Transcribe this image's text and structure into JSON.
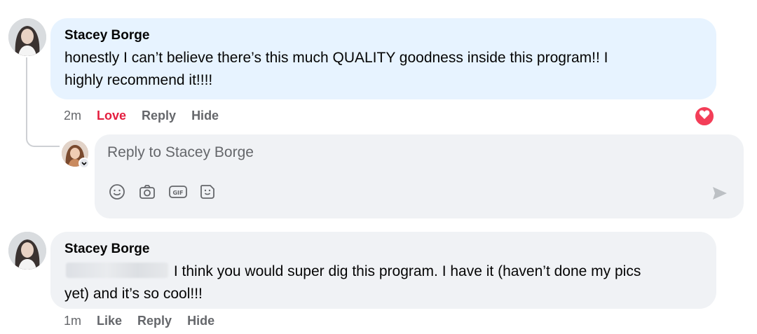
{
  "comments": [
    {
      "author": "Stacey Borge",
      "text_line1": "honestly I can’t believe there’s this much QUALITY goodness inside this program!! I",
      "text_line2": "highly recommend it!!!!",
      "time": "2m",
      "react_label": "Love",
      "reply_label": "Reply",
      "hide_label": "Hide",
      "reaction_icon": "heart-icon",
      "reaction_color": "#f33e58"
    },
    {
      "author": "Stacey Borge",
      "text_line1_rest": "I think you would super dig this program. I have it (haven’t done my pics",
      "text_line2": "yet) and it’s so cool!!!",
      "time": "1m",
      "react_label": "Like",
      "reply_label": "Reply",
      "hide_label": "Hide"
    }
  ],
  "reply_box": {
    "placeholder": "Reply to Stacey Borge",
    "icons": [
      "emoji-icon",
      "camera-icon",
      "gif-icon",
      "sticker-icon",
      "send-icon"
    ]
  },
  "colors": {
    "bubble_highlight": "#e7f3ff",
    "bubble_default": "#f0f2f5",
    "love": "#e41e3f",
    "meta_text": "#65676b"
  }
}
